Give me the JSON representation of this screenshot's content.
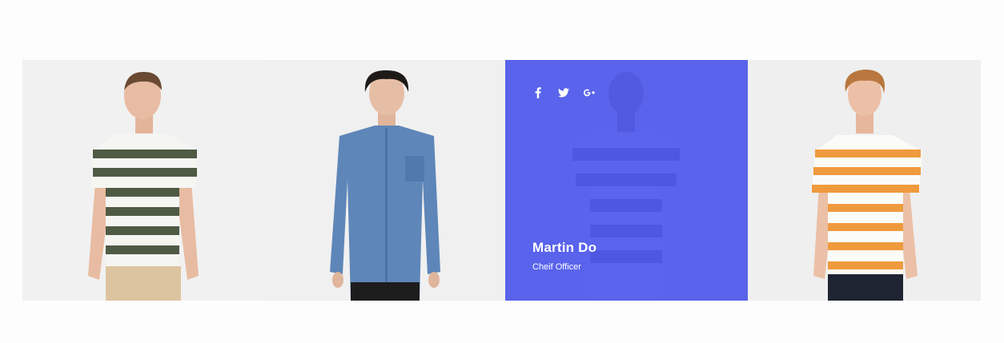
{
  "team": {
    "featured": {
      "name": "Martin Do",
      "role": "Cheif Officer",
      "overlay_color": "#5058EB"
    },
    "socials": [
      {
        "icon": "facebook-icon"
      },
      {
        "icon": "twitter-icon"
      },
      {
        "icon": "google-plus-icon"
      }
    ],
    "members": [
      {
        "photo": "man in green striped t-shirt"
      },
      {
        "photo": "man in denim shirt"
      },
      {
        "photo": "man in dark striped t-shirt"
      },
      {
        "photo": "man in orange striped t-shirt"
      }
    ]
  }
}
